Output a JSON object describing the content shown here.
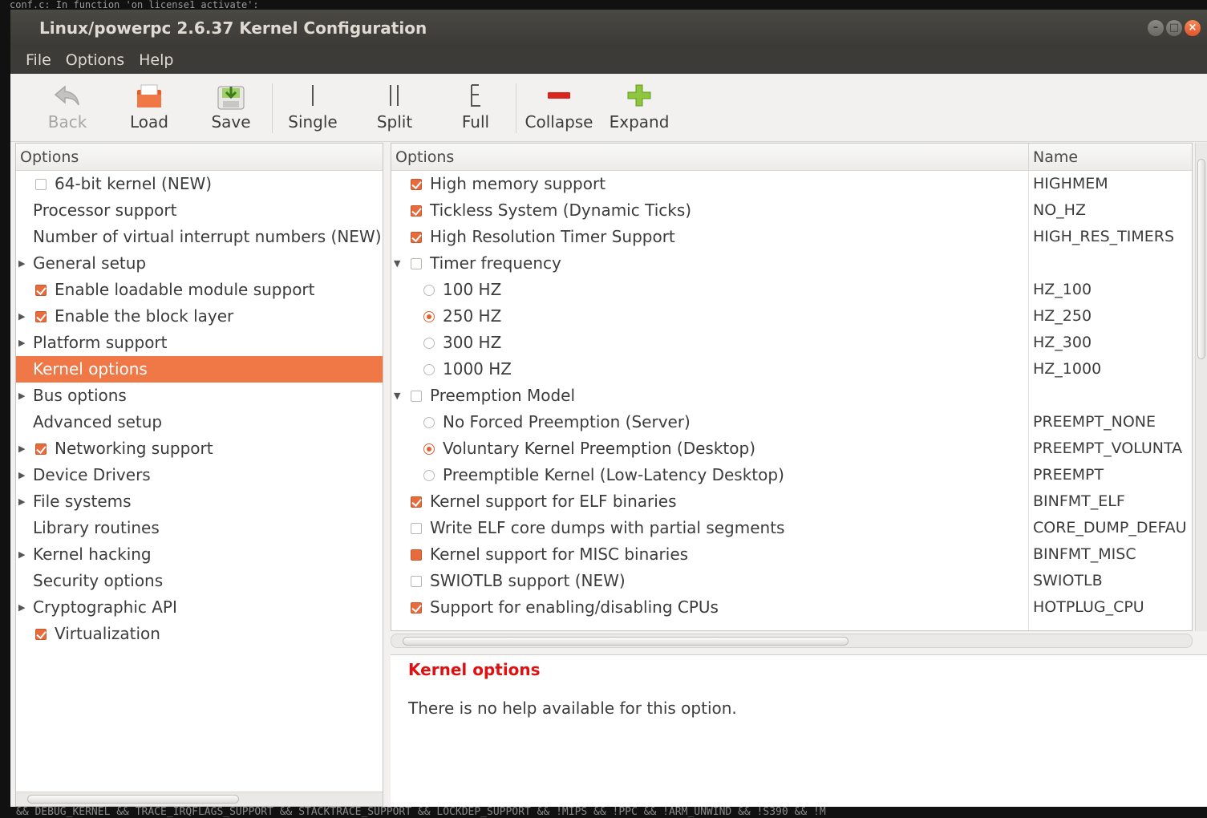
{
  "terminal": {
    "top_line": "conf.c: In function 'on_license1_activate':",
    "bottom_line": "&& DEBUG_KERNEL && TRACE_IRQFLAGS_SUPPORT && STACKTRACE_SUPPORT && LOCKDEP_SUPPORT && !MIPS && !PPC && !ARM_UNWIND && !S390 && !M"
  },
  "window": {
    "title": "Linux/powerpc 2.6.37 Kernel Configuration",
    "controls": {
      "minimize": "–",
      "maximize": "□",
      "close": "×"
    }
  },
  "menubar": [
    "File",
    "Options",
    "Help"
  ],
  "toolbar": {
    "back": "Back",
    "load": "Load",
    "save": "Save",
    "single": "Single",
    "split": "Split",
    "full": "Full",
    "collapse": "Collapse",
    "expand": "Expand"
  },
  "left": {
    "header": "Options",
    "items": [
      {
        "label": "64-bit kernel (NEW)",
        "check": "unchecked",
        "expander": false
      },
      {
        "label": "Processor support",
        "check": "none",
        "expander": false
      },
      {
        "label": "Number of virtual interrupt numbers (NEW)",
        "check": "none",
        "expander": false
      },
      {
        "label": "General setup",
        "check": "none",
        "expander": true
      },
      {
        "label": "Enable loadable module support",
        "check": "checked",
        "expander": false
      },
      {
        "label": "Enable the block layer",
        "check": "checked",
        "expander": true
      },
      {
        "label": "Platform support",
        "check": "none",
        "expander": true
      },
      {
        "label": "Kernel options",
        "check": "none",
        "expander": false,
        "selected": true
      },
      {
        "label": "Bus options",
        "check": "none",
        "expander": true
      },
      {
        "label": "Advanced setup",
        "check": "none",
        "expander": false
      },
      {
        "label": "Networking support",
        "check": "checked",
        "expander": true
      },
      {
        "label": "Device Drivers",
        "check": "none",
        "expander": true
      },
      {
        "label": "File systems",
        "check": "none",
        "expander": true
      },
      {
        "label": "Library routines",
        "check": "none",
        "expander": false
      },
      {
        "label": "Kernel hacking",
        "check": "none",
        "expander": true
      },
      {
        "label": "Security options",
        "check": "none",
        "expander": false
      },
      {
        "label": "Cryptographic API",
        "check": "none",
        "expander": true
      },
      {
        "label": "Virtualization",
        "check": "checked",
        "expander": false
      }
    ]
  },
  "right": {
    "header_options": "Options",
    "header_name": "Name",
    "rows": [
      {
        "label": "High memory support",
        "name": "HIGHMEM",
        "control": "checked",
        "indent": 0,
        "expander": false
      },
      {
        "label": "Tickless System (Dynamic Ticks)",
        "name": "NO_HZ",
        "control": "checked",
        "indent": 0,
        "expander": false
      },
      {
        "label": "High Resolution Timer Support",
        "name": "HIGH_RES_TIMERS",
        "control": "checked",
        "indent": 0,
        "expander": false
      },
      {
        "label": "Timer frequency",
        "name": "",
        "control": "unchecked",
        "indent": 0,
        "expander": true
      },
      {
        "label": "100 HZ",
        "name": "HZ_100",
        "control": "radio-off",
        "indent": 1,
        "expander": false
      },
      {
        "label": "250 HZ",
        "name": "HZ_250",
        "control": "radio-on",
        "indent": 1,
        "expander": false
      },
      {
        "label": "300 HZ",
        "name": "HZ_300",
        "control": "radio-off",
        "indent": 1,
        "expander": false
      },
      {
        "label": "1000 HZ",
        "name": "HZ_1000",
        "control": "radio-off",
        "indent": 1,
        "expander": false
      },
      {
        "label": "Preemption Model",
        "name": "",
        "control": "unchecked",
        "indent": 0,
        "expander": true
      },
      {
        "label": "No Forced Preemption (Server)",
        "name": "PREEMPT_NONE",
        "control": "radio-off",
        "indent": 1,
        "expander": false
      },
      {
        "label": "Voluntary Kernel Preemption (Desktop)",
        "name": "PREEMPT_VOLUNTA",
        "control": "radio-on",
        "indent": 1,
        "expander": false
      },
      {
        "label": "Preemptible Kernel (Low-Latency Desktop)",
        "name": "PREEMPT",
        "control": "radio-off",
        "indent": 1,
        "expander": false
      },
      {
        "label": "Kernel support for ELF binaries",
        "name": "BINFMT_ELF",
        "control": "checked",
        "indent": 0,
        "expander": false
      },
      {
        "label": "Write ELF core dumps with partial segments",
        "name": "CORE_DUMP_DEFAU",
        "control": "unchecked",
        "indent": 0,
        "expander": false
      },
      {
        "label": "Kernel support for MISC binaries",
        "name": "BINFMT_MISC",
        "control": "partial",
        "indent": 0,
        "expander": false
      },
      {
        "label": "SWIOTLB support (NEW)",
        "name": "SWIOTLB",
        "control": "unchecked",
        "indent": 0,
        "expander": false
      },
      {
        "label": "Support for enabling/disabling CPUs",
        "name": "HOTPLUG_CPU",
        "control": "checked",
        "indent": 0,
        "expander": false
      }
    ]
  },
  "help": {
    "title": "Kernel options",
    "text": "There is no help available for this option."
  },
  "colors": {
    "accent": "#f07746",
    "titlebar": "#3c3b37",
    "help_title": "#e01010"
  }
}
